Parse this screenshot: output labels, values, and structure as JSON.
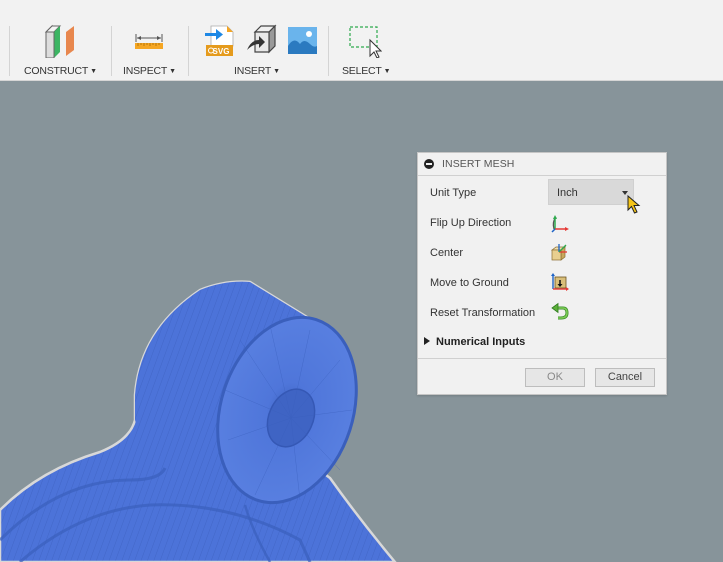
{
  "toolbar": {
    "groups": [
      {
        "label": "CONSTRUCT",
        "icons": [
          "construct-plane-icon"
        ]
      },
      {
        "label": "INSPECT",
        "icons": [
          "measure-ruler-icon"
        ]
      },
      {
        "label": "INSERT",
        "icons": [
          "insert-svg-icon",
          "insert-mesh-icon",
          "insert-image-icon"
        ]
      },
      {
        "label": "SELECT",
        "icons": [
          "window-select-icon"
        ]
      }
    ],
    "svg_badge": "SVG"
  },
  "dialog": {
    "title": "INSERT MESH",
    "rows": [
      {
        "label": "Unit Type",
        "control": "select",
        "value": "Inch"
      },
      {
        "label": "Flip Up Direction",
        "icon": "flip-axis-icon"
      },
      {
        "label": "Center",
        "icon": "center-box-icon"
      },
      {
        "label": "Move to Ground",
        "icon": "move-to-ground-icon"
      },
      {
        "label": "Reset Transformation",
        "icon": "reset-arrow-icon"
      }
    ],
    "numerical_inputs": "Numerical Inputs",
    "ok_label": "OK",
    "cancel_label": "Cancel"
  },
  "colors": {
    "toolbar_bg": "#f2f2f2",
    "viewport_bg": "#87949a",
    "mesh_blue": "#4a72d8",
    "dialog_bg": "#f1f1f1"
  }
}
